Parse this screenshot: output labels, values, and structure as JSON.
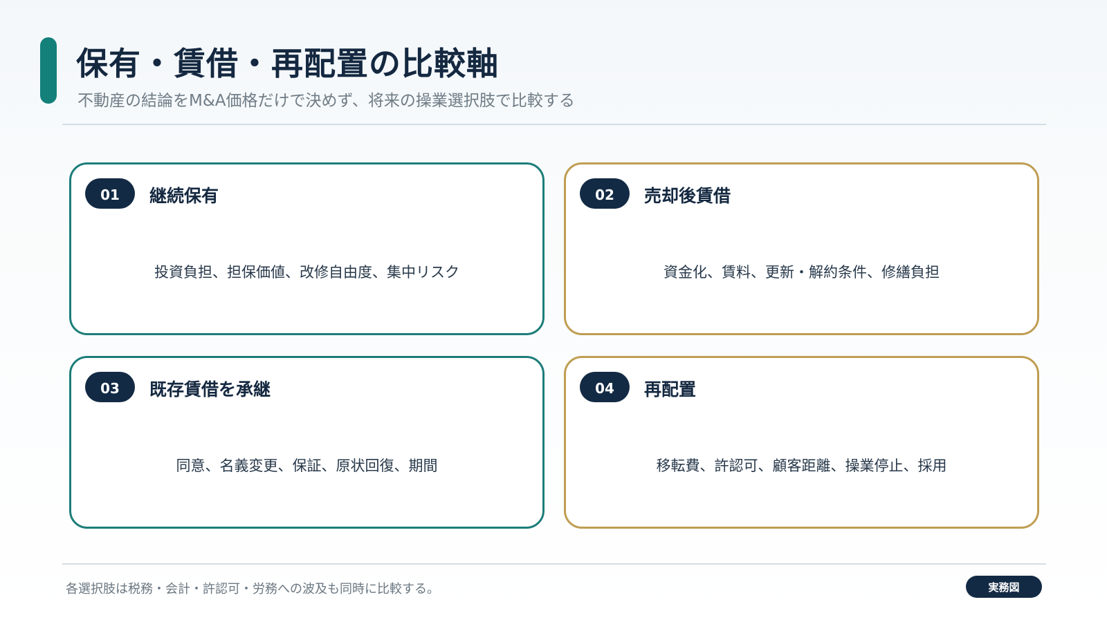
{
  "header": {
    "title": "保有・賃借・再配置の比較軸",
    "subtitle": "不動産の結論をM&A価格だけで決めず、将来の操業選択肢で比較する"
  },
  "cards": [
    {
      "number": "01",
      "title": "継続保有",
      "description": "投資負担、担保価値、改修自由度、集中リスク"
    },
    {
      "number": "02",
      "title": "売却後賃借",
      "description": "資金化、賃料、更新・解約条件、修繕負担"
    },
    {
      "number": "03",
      "title": "既存賃借を承継",
      "description": "同意、名義変更、保証、原状回復、期間"
    },
    {
      "number": "04",
      "title": "再配置",
      "description": "移転費、許認可、顧客距離、操業停止、採用"
    }
  ],
  "footer": {
    "note": "各選択肢は税務・会計・許認可・労務への波及も同時に比較する。",
    "badge": "実務図"
  },
  "colors": {
    "teal": "#13807a",
    "gold": "#bf9d52",
    "navy": "#132a44"
  }
}
